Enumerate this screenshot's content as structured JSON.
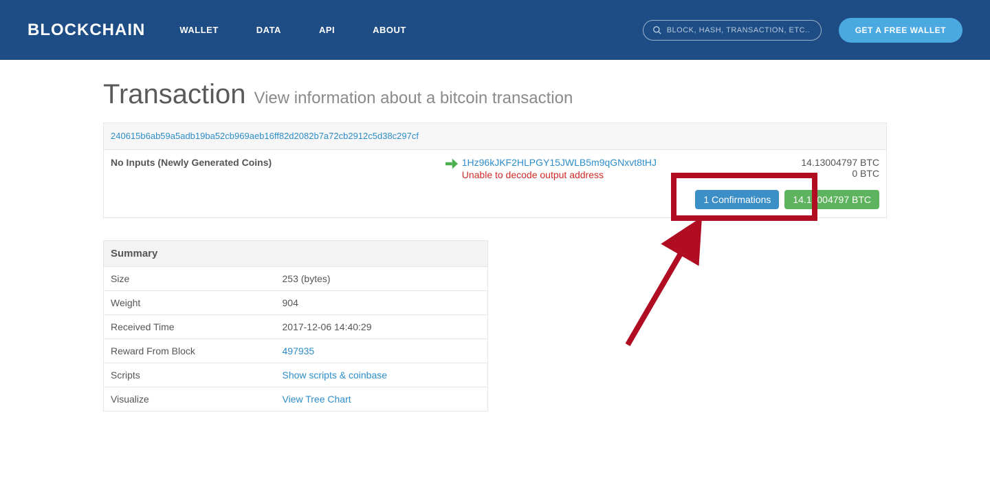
{
  "header": {
    "logo": "BLOCKCHAIN",
    "nav": {
      "wallet": "WALLET",
      "data": "DATA",
      "api": "API",
      "about": "ABOUT"
    },
    "search_placeholder": "BLOCK, HASH, TRANSACTION, ETC...",
    "cta": "GET A FREE WALLET"
  },
  "page": {
    "title": "Transaction",
    "subtitle": "View information about a bitcoin transaction"
  },
  "tx": {
    "hash": "240615b6ab59a5adb19ba52cb969aeb16ff82d2082b7a72cb2912c5d38c297cf",
    "inputs_label": "No Inputs (Newly Generated Coins)",
    "outputs": {
      "addr": "1Hz96kJKF2HLPGY15JWLB5m9qGNxvt8tHJ",
      "decode_err": "Unable to decode output address",
      "amount1": "14.13004797 BTC",
      "amount2": "0 BTC"
    },
    "confirmations": "1 Confirmations",
    "total": "14.13004797 BTC"
  },
  "summary": {
    "header": "Summary",
    "rows": {
      "size": {
        "label": "Size",
        "value": "253 (bytes)"
      },
      "weight": {
        "label": "Weight",
        "value": "904"
      },
      "received": {
        "label": "Received Time",
        "value": "2017-12-06 14:40:29"
      },
      "reward": {
        "label": "Reward From Block",
        "value": "497935"
      },
      "scripts": {
        "label": "Scripts",
        "value": "Show scripts & coinbase"
      },
      "visualize": {
        "label": "Visualize",
        "value": "View Tree Chart"
      }
    }
  }
}
